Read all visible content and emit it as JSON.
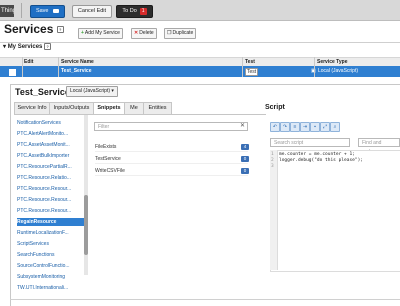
{
  "toolbar": {
    "thing_label": "Thing",
    "save_label": "Save",
    "cancel_label": "Cancel Edit",
    "todo_label": "To Do",
    "todo_count": "1"
  },
  "page": {
    "title": "Services",
    "help": "?"
  },
  "actions": {
    "add_label": "Add My Service",
    "delete_label": "Delete",
    "duplicate_label": "Duplicate"
  },
  "my_services": {
    "header": "My Services",
    "help": "?",
    "columns": [
      "Edit",
      "Service Name",
      "Test",
      "Service Type"
    ],
    "row": {
      "name": "Test_Service",
      "test": "Test",
      "type": "Local (JavaScript)"
    }
  },
  "detail": {
    "title": "Test_Service",
    "language": "Local (JavaScript)",
    "tabs": [
      "Service Info",
      "Inputs/Outputs",
      "Snippets",
      "Me",
      "Entities"
    ],
    "active_tab": "Snippets"
  },
  "service_list": [
    {
      "label": "NotificationServices",
      "count": "3",
      "color": "green"
    },
    {
      "label": "PTC.AlertAlertMonito...",
      "count": "6",
      "color": "blue"
    },
    {
      "label": "PTC.AssetAssetMonit...",
      "count": "3",
      "color": "blue"
    },
    {
      "label": "PTC.AssetBulkImporter",
      "count": "1",
      "color": "blue"
    },
    {
      "label": "PTC.ResourcePartialR...",
      "count": "1",
      "color": "blue"
    },
    {
      "label": "PTC.Resource.Relatio...",
      "count": "9",
      "color": "blue"
    },
    {
      "label": "PTC.Resource.Resour...",
      "count": "4",
      "color": "blue"
    },
    {
      "label": "PTC.Resource.Resour...",
      "count": "9",
      "color": "blue"
    },
    {
      "label": "PTC.Resource.Resour...",
      "count": "1",
      "color": "blue"
    },
    {
      "label": "RegainResource",
      "count": "2",
      "color": "green"
    },
    {
      "label": "RuntimeLocalizationF...",
      "count": "3",
      "color": "green"
    },
    {
      "label": "ScriptServices",
      "count": "3",
      "color": "green"
    },
    {
      "label": "SearchFunctions",
      "count": "20",
      "color": "green"
    },
    {
      "label": "SourceControlFunctio...",
      "count": "4",
      "color": "green"
    },
    {
      "label": "SubsystemMonitoring",
      "count": "1",
      "color": "green"
    },
    {
      "label": "TW.UTI.Internationali...",
      "count": "1",
      "color": "gray"
    }
  ],
  "selected_service": "RegainResource",
  "snippets": {
    "filter_placeholder": "Filter",
    "items": [
      {
        "label": "FileExists",
        "count": "4"
      },
      {
        "label": "TestService",
        "count": "0"
      },
      {
        "label": "WriteCSVFile",
        "count": "0"
      }
    ]
  },
  "script": {
    "label": "Script",
    "search_placeholder": "Search script",
    "find_replace_placeholder": "Find and replace",
    "lines": [
      {
        "no": "1",
        "code": "me.counter = me.counter + 1;"
      },
      {
        "no": "2",
        "code": "logger.debug(\"do this please\");"
      },
      {
        "no": "3",
        "code": ""
      }
    ]
  },
  "colors": {
    "accent": "#2f7fd1",
    "save": "#1f6fc4",
    "todo": "#2d2d2d",
    "badge_green": "#3da33a",
    "badge_blue": "#3a6fb5",
    "badge_red": "#d62b2b"
  }
}
